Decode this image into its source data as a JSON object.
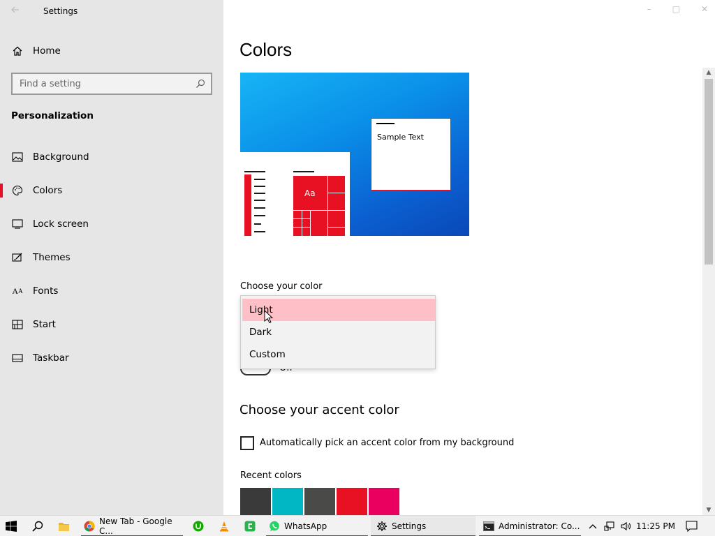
{
  "app": {
    "title": "Settings"
  },
  "sidebar": {
    "home_label": "Home",
    "search_placeholder": "Find a setting",
    "section_title": "Personalization",
    "items": [
      {
        "label": "Background",
        "icon": "image-icon"
      },
      {
        "label": "Colors",
        "icon": "palette-icon",
        "active": true
      },
      {
        "label": "Lock screen",
        "icon": "lock-screen-icon"
      },
      {
        "label": "Themes",
        "icon": "themes-icon"
      },
      {
        "label": "Fonts",
        "icon": "fonts-icon"
      },
      {
        "label": "Start",
        "icon": "start-icon"
      },
      {
        "label": "Taskbar",
        "icon": "taskbar-icon"
      }
    ]
  },
  "main": {
    "title": "Colors",
    "preview": {
      "sample_text": "Sample Text",
      "tile_text": "Aa"
    },
    "choose_color": {
      "label": "Choose your color",
      "options": [
        "Light",
        "Dark",
        "Custom"
      ],
      "hovered": "Light"
    },
    "transparency_toggle_state": "Off",
    "accent": {
      "title": "Choose your accent color",
      "auto_pick_label": "Automatically pick an accent color from my background",
      "auto_pick_checked": false,
      "recent_colors_label": "Recent colors",
      "recent_colors": [
        "#3a3a3a",
        "#00b7c3",
        "#4a4a48",
        "#e81123",
        "#ea005e"
      ]
    }
  },
  "colors": {
    "accent": "#e81123",
    "hover_option": "#ffbfc6"
  },
  "taskbar": {
    "apps": [
      {
        "label": "New Tab - Google C...",
        "icon": "chrome-icon",
        "running": true
      },
      {
        "label": "",
        "icon": "upwork-icon",
        "running": false
      },
      {
        "label": "",
        "icon": "vlc-icon",
        "running": false
      },
      {
        "label": "",
        "icon": "camtasia-icon",
        "running": false
      },
      {
        "label": "WhatsApp",
        "icon": "whatsapp-icon",
        "running": true
      },
      {
        "label": "Settings",
        "icon": "gear-icon",
        "running": true,
        "active": true
      },
      {
        "label": "Administrator:  Co...",
        "icon": "cmd-icon",
        "running": true
      }
    ],
    "clock": "11:25 PM"
  }
}
